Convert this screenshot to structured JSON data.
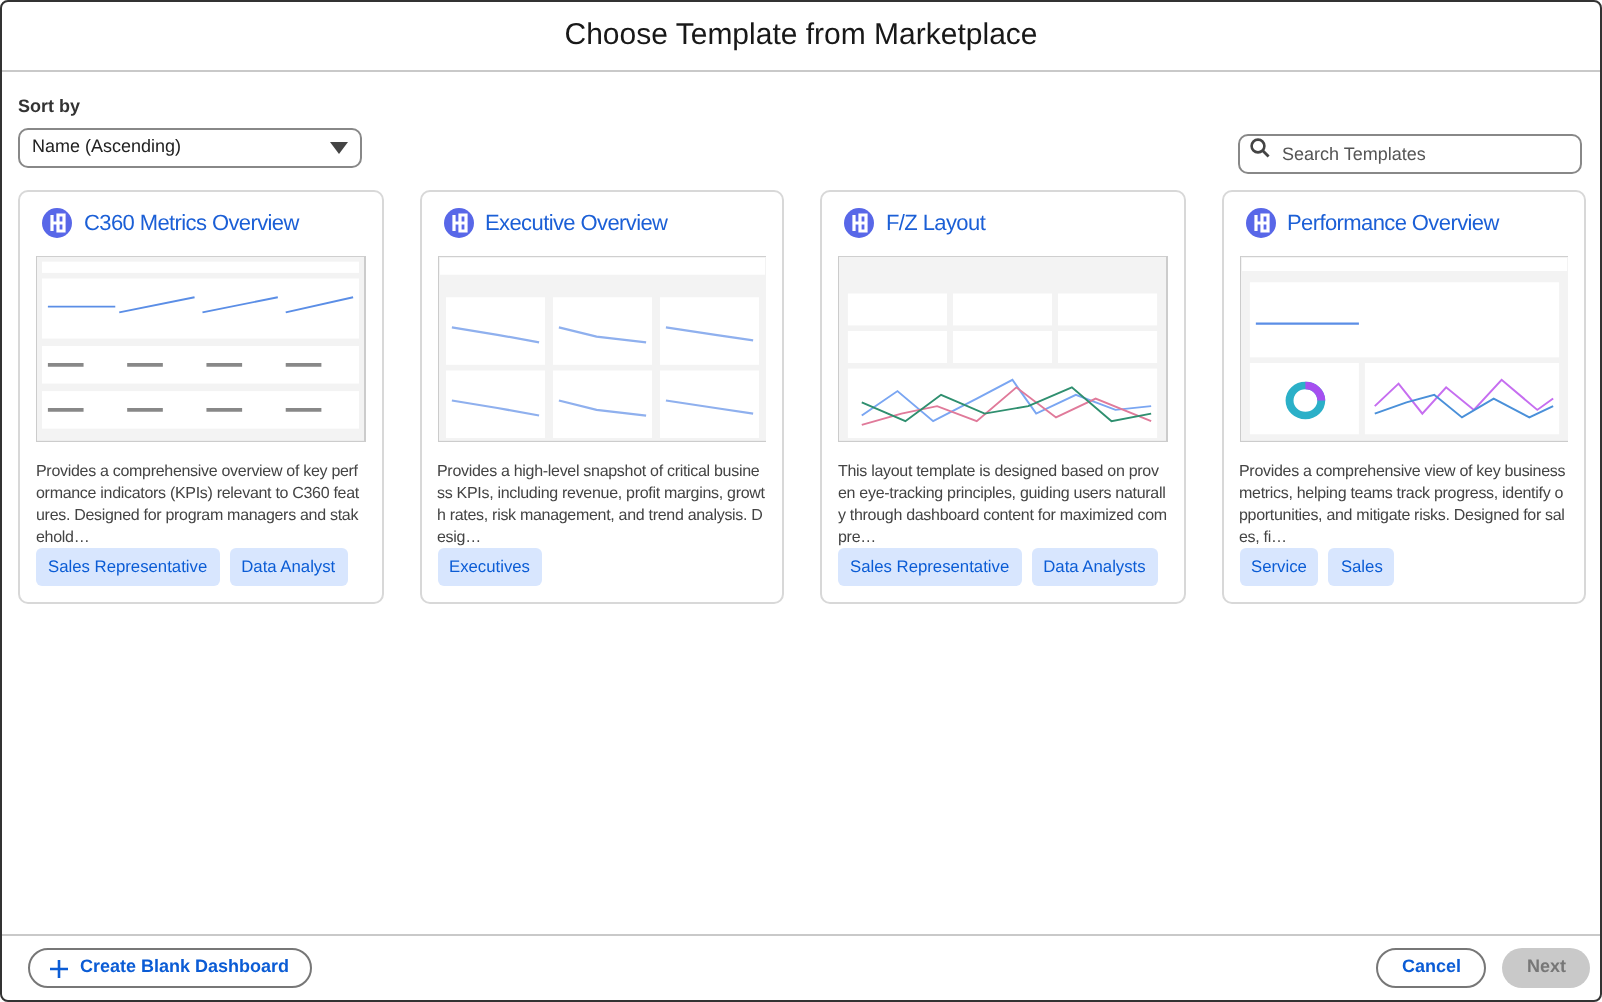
{
  "dialog": {
    "title": "Choose Template from Marketplace"
  },
  "sort": {
    "label": "Sort by",
    "value": "Name (Ascending)"
  },
  "search": {
    "placeholder": "Search Templates"
  },
  "templates": [
    {
      "title": "C360 Metrics Overview",
      "preview": {
        "kind": "picture"
      },
      "description": "Provides a comprehensive overview of key performance indicators (KPIs) relevant to C360 features. Designed for program managers and stakehold…",
      "tags": [
        "Sales Representative",
        "Data Analyst"
      ]
    },
    {
      "title": "Executive Overview",
      "preview": {
        "kind": "picture"
      },
      "description": "Provides a high-level snapshot of critical business KPIs, including revenue, profit margins, growth rates, risk management, and trend analysis. Desig…",
      "tags": [
        "Executives"
      ]
    },
    {
      "title": "F/Z Layout",
      "preview": {
        "kind": "picture"
      },
      "description": "This layout template is designed based on proven eye-tracking principles, guiding users naturally through dashboard content for maximized compre…",
      "tags": [
        "Sales Representative",
        "Data Analysts"
      ]
    },
    {
      "title": "Performance Overview",
      "preview": {
        "kind": "picture"
      },
      "description": "Provides a comprehensive view of key business metrics, helping teams track progress, identify opportunities, and mitigate risks. Designed for sales, fi…",
      "tags": [
        "Service",
        "Sales"
      ]
    }
  ],
  "footer": {
    "create_button": "Create Blank Dashboard",
    "cancel_button": "Cancel",
    "next_button": {
      "label": "Next",
      "disabled": true
    }
  }
}
